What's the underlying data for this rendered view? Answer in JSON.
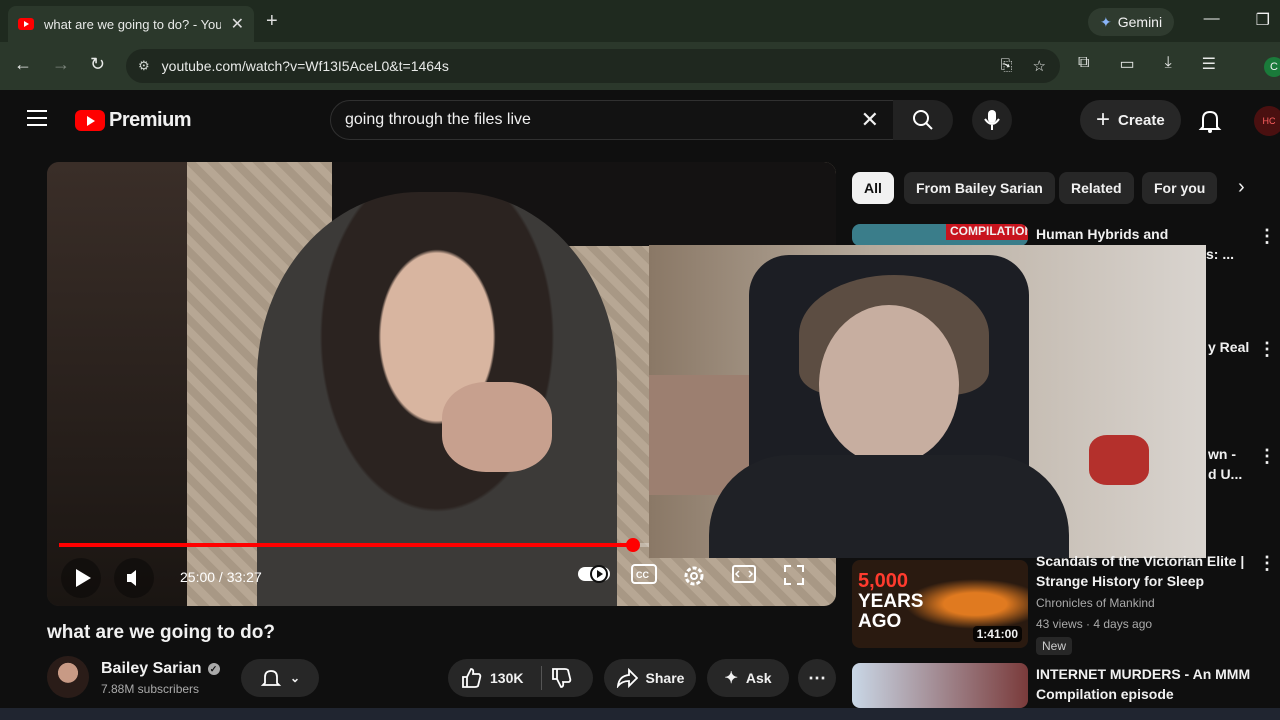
{
  "browser": {
    "tab_title": "what are we going to do? - You",
    "url": "youtube.com/watch?v=Wf13I5AceL0&t=1464s",
    "gemini_label": "Gemini",
    "profile_initial": "C"
  },
  "youtube": {
    "logo_text": "Premium",
    "search_query": "going through the files  live",
    "create_label": "Create",
    "avatar_text": "HC"
  },
  "player": {
    "time": "25:00 / 33:27",
    "progress": 0.747
  },
  "video": {
    "title": "what are we going to do?",
    "channel": "Bailey Sarian",
    "subscribers": "7.88M subscribers",
    "likes": "130K",
    "share_label": "Share",
    "ask_label": "Ask"
  },
  "chips": [
    "All",
    "From Bailey Sarian",
    "Related",
    "For you"
  ],
  "sidebar": {
    "item1": {
      "badge": "COMPILATION",
      "title": "Human Hybrids and",
      "title_tail": "s: ..."
    },
    "item2": {
      "title_tail": "y Real"
    },
    "item3": {
      "title_tail1": "wn -",
      "title_tail2": "d U..."
    },
    "item4": {
      "title": "Scandals of the Victorian Elite | Strange History for Sleep",
      "channel": "Chronicles of Mankind",
      "meta": "43 views · 4 days ago",
      "badge": "New",
      "duration": "1:41:00",
      "thumb_text1": "5,000",
      "thumb_text2": "YEARS AGO"
    },
    "item5": {
      "title": "INTERNET MURDERS - An MMM Compilation episode"
    }
  },
  "colors": {
    "accent": "#ff0000",
    "bg": "#0f0f0f"
  }
}
